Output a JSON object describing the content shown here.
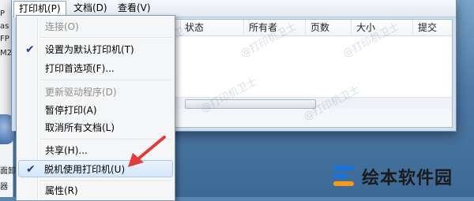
{
  "menubar": {
    "items": [
      {
        "label": "打印机(P)"
      },
      {
        "label": "文档(D)"
      },
      {
        "label": "查看(V)"
      }
    ]
  },
  "columns": [
    "状态",
    "所有者",
    "页数",
    "大小",
    "提交"
  ],
  "left_strip": [
    "P",
    "FP",
    "M2",
    "as",
    "面卸",
    "器"
  ],
  "dropdown": {
    "items": [
      {
        "label": "连接(O)",
        "disabled": true
      },
      {
        "label": "设置为默认打印机(T)",
        "checked": true
      },
      {
        "label": "打印首选项(F)..."
      },
      {
        "label": "更新驱动程序(D)",
        "disabled": true
      },
      {
        "label": "暂停打印(A)"
      },
      {
        "label": "取消所有文档(L)"
      },
      {
        "label": "共享(H)..."
      },
      {
        "label": "脱机使用打印机(U)",
        "checked": true,
        "highlighted": true
      },
      {
        "label": "属性(R)"
      }
    ]
  },
  "watermark": "@打印机卫士",
  "logo": {
    "text": "绘本软件园"
  },
  "colors": {
    "arrow": "#e23b3b",
    "check": "#1d3d8f",
    "logo_blue": "#1a73d9",
    "logo_orange": "#f39a1e"
  },
  "icons": {
    "check": "check-icon",
    "arrow": "annotation-arrow-icon",
    "logo": "logo-icon"
  }
}
